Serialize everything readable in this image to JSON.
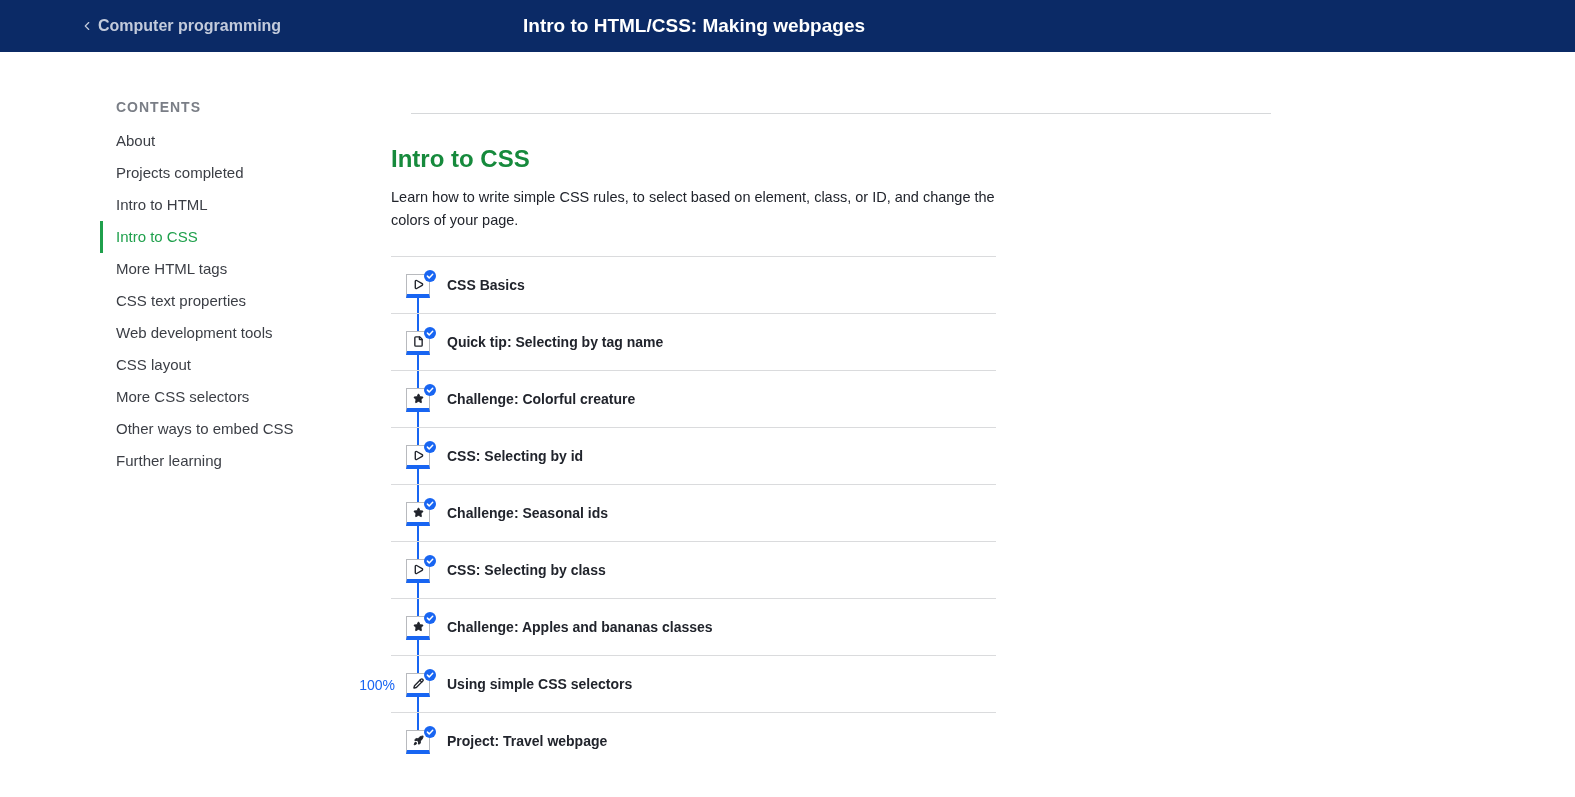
{
  "header": {
    "back_link": "Computer programming",
    "title": "Intro to HTML/CSS: Making webpages"
  },
  "sidebar": {
    "heading": "CONTENTS",
    "items": [
      {
        "label": "About",
        "selected": false
      },
      {
        "label": "Projects completed",
        "selected": false
      },
      {
        "label": "Intro to HTML",
        "selected": false
      },
      {
        "label": "Intro to CSS",
        "selected": true
      },
      {
        "label": "More HTML tags",
        "selected": false
      },
      {
        "label": "CSS text properties",
        "selected": false
      },
      {
        "label": "Web development tools",
        "selected": false
      },
      {
        "label": "CSS layout",
        "selected": false
      },
      {
        "label": "More CSS selectors",
        "selected": false
      },
      {
        "label": "Other ways to embed CSS",
        "selected": false
      },
      {
        "label": "Further learning",
        "selected": false
      }
    ]
  },
  "unit": {
    "title": "Intro to CSS",
    "description": "Learn how to write simple CSS rules, to select based on element, class, or ID, and change the colors of your page."
  },
  "lessons": [
    {
      "kind": "video",
      "title": "CSS Basics",
      "completed": true
    },
    {
      "kind": "article",
      "title": "Quick tip: Selecting by tag name",
      "completed": true
    },
    {
      "kind": "challenge",
      "title": "Challenge: Colorful creature",
      "completed": true
    },
    {
      "kind": "video",
      "title": "CSS: Selecting by id",
      "completed": true
    },
    {
      "kind": "challenge",
      "title": "Challenge: Seasonal ids",
      "completed": true
    },
    {
      "kind": "video",
      "title": "CSS: Selecting by class",
      "completed": true
    },
    {
      "kind": "challenge",
      "title": "Challenge: Apples and bananas classes",
      "completed": true
    },
    {
      "kind": "exercise",
      "title": "Using simple CSS selectors",
      "completed": true,
      "progress": "100%"
    },
    {
      "kind": "project",
      "title": "Project: Travel webpage",
      "completed": true
    }
  ]
}
